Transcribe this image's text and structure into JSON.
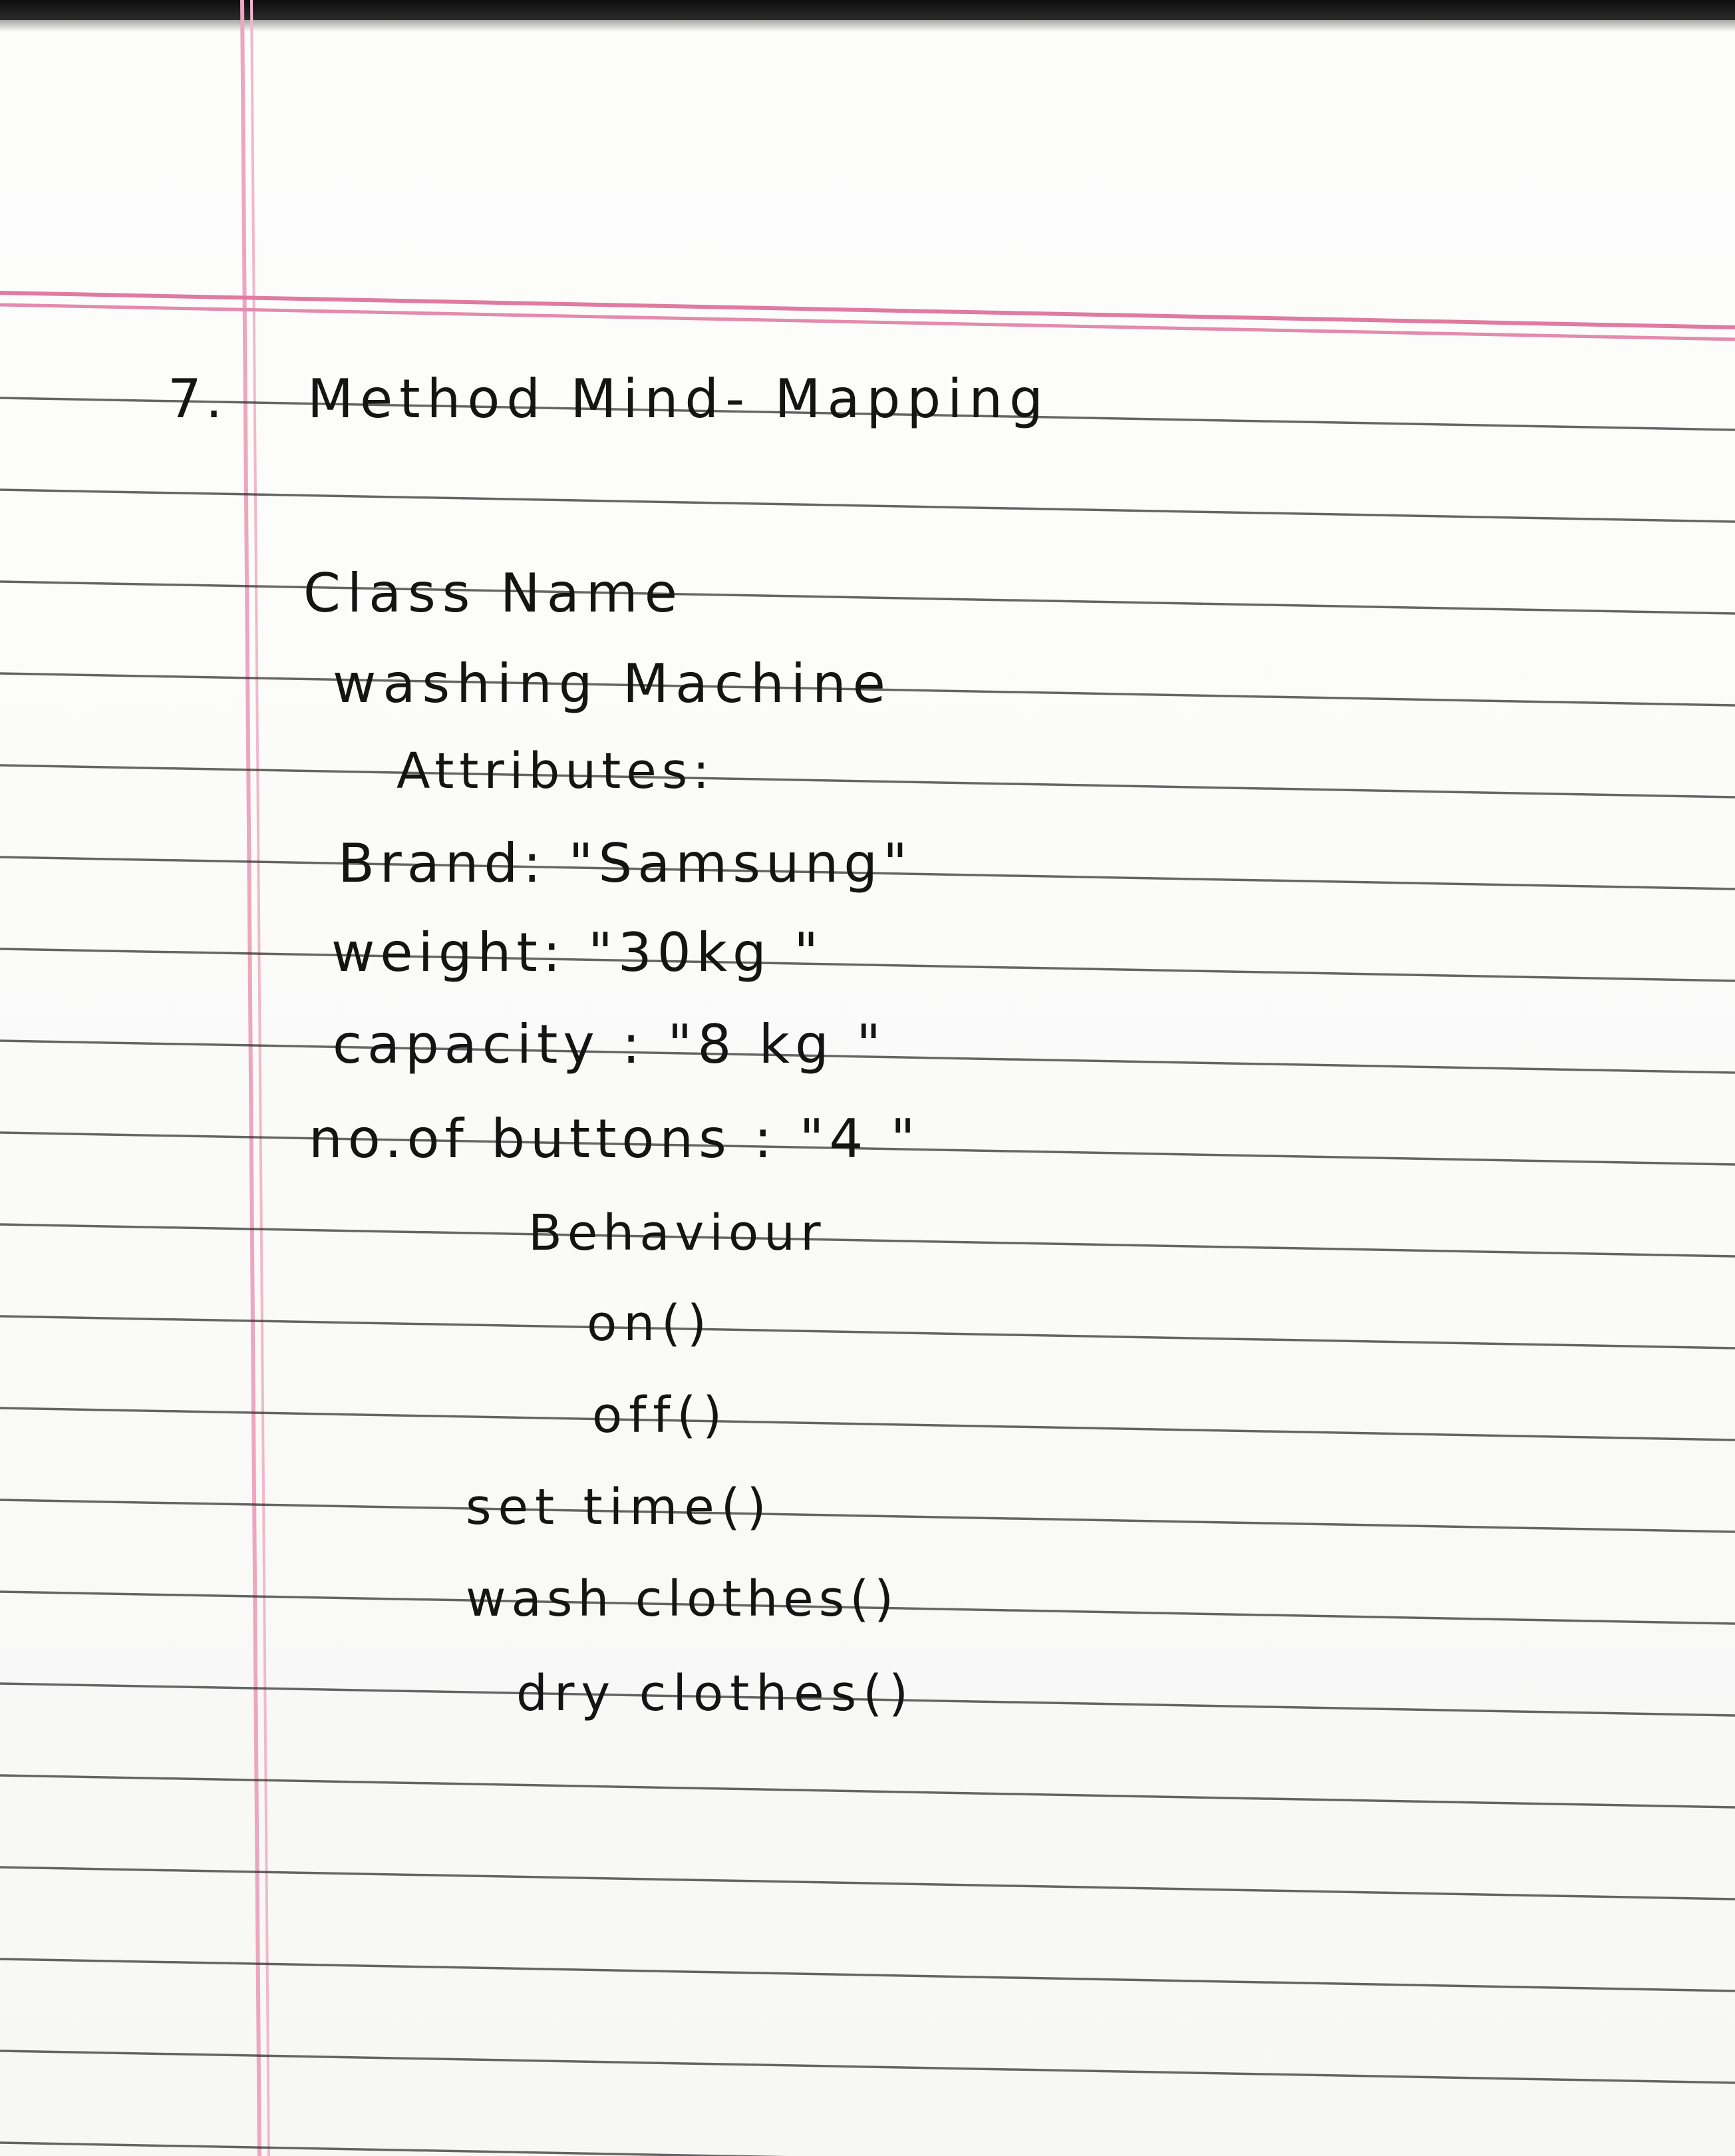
{
  "note": {
    "question_number": "7.",
    "title": "Method Mind- Mapping",
    "class_heading": "Class Name",
    "class_name": "washing Machine",
    "attributes_heading": "Attributes:",
    "attributes": [
      "Brand: \"Samsung\"",
      "weight: \"30kg \"",
      "capacity : \"8 kg \"",
      "no.of buttons : \"4 \""
    ],
    "behaviour_heading": "Behaviour",
    "behaviours": [
      "on()",
      "off()",
      "set time()",
      "wash clothes()",
      "dry clothes()"
    ]
  }
}
